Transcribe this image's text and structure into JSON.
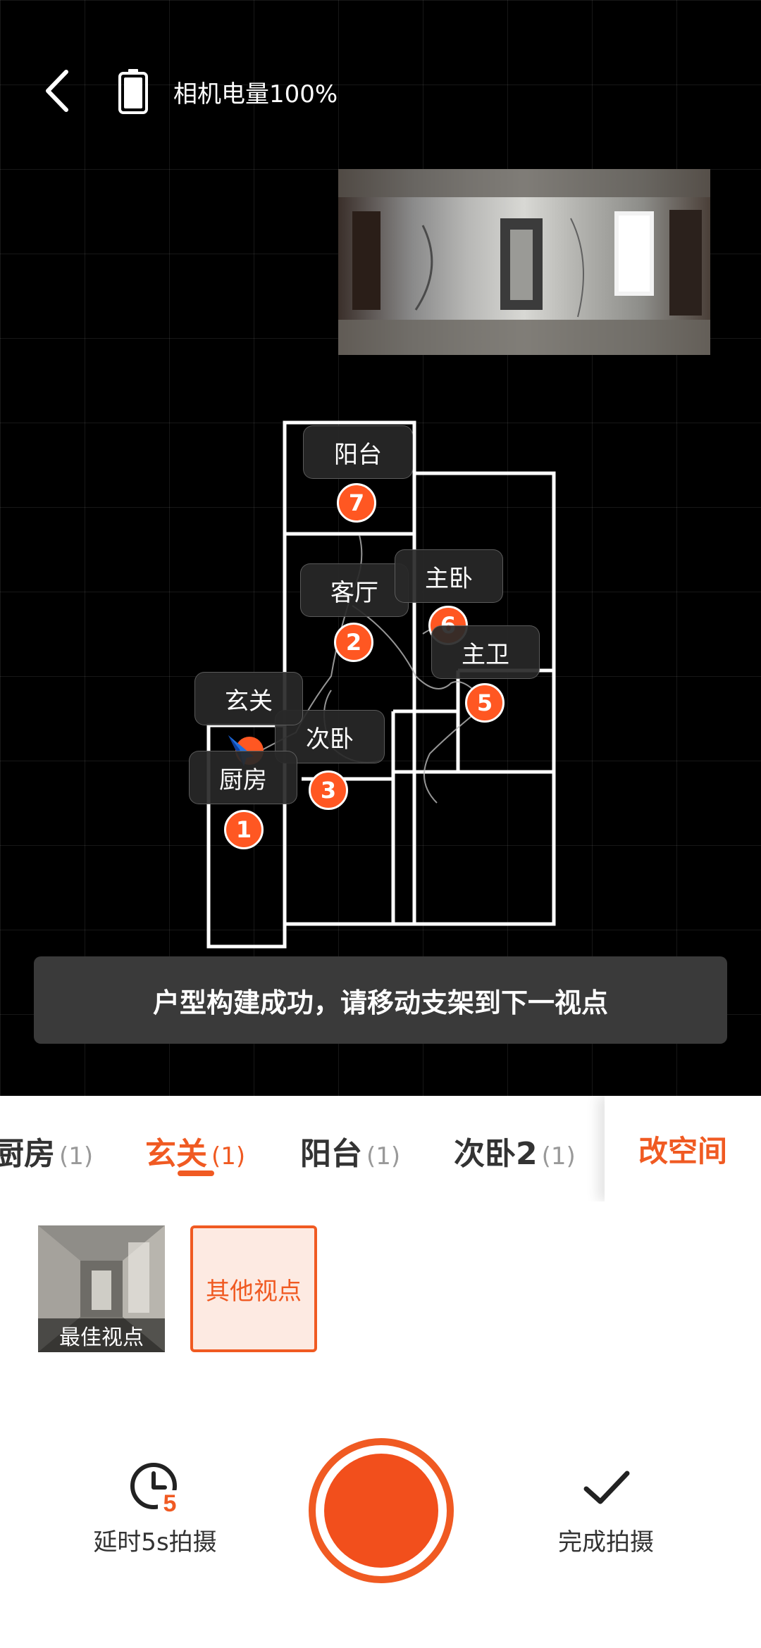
{
  "header": {
    "battery_text": "相机电量100%",
    "back_icon": "chevron-left-icon",
    "battery_icon": "battery-full-icon"
  },
  "floorplan": {
    "rooms": [
      {
        "label": "阳台",
        "pin": "7"
      },
      {
        "label": "客厅",
        "pin": "2"
      },
      {
        "label": "主卧",
        "pin": "6"
      },
      {
        "label": "主卫",
        "pin": "5"
      },
      {
        "label": "玄关",
        "pin": ""
      },
      {
        "label": "次卧",
        "pin": "3"
      },
      {
        "label": "厨房",
        "pin": "1"
      }
    ]
  },
  "toast": "户型构建成功，请移动支架到下一视点",
  "tabs": [
    {
      "name": "厨房",
      "count": "(1)"
    },
    {
      "name": "玄关",
      "count": "(1)"
    },
    {
      "name": "阳台",
      "count": "(1)"
    },
    {
      "name": "次卧2",
      "count": "(1)"
    }
  ],
  "change_space": "改空间",
  "viewpoints": {
    "best_caption": "最佳视点",
    "other_label": "其他视点"
  },
  "controls": {
    "timer_label": "延时5s拍摄",
    "timer_badge": "5",
    "done_label": "完成拍摄"
  },
  "colors": {
    "accent": "#f05a22",
    "pin": "#ff5722"
  }
}
